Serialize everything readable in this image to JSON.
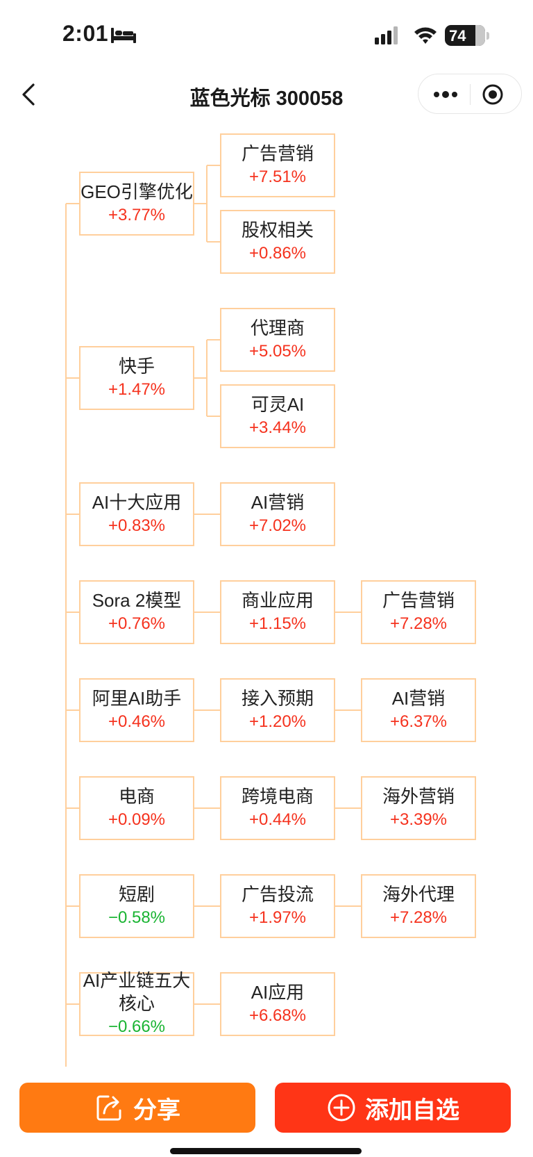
{
  "status_bar": {
    "time": "2:01",
    "battery": "74",
    "battery_level": 0.74
  },
  "nav": {
    "title": "蓝色光标 300058"
  },
  "colors": {
    "node_border": "#ffcf9c",
    "up": "#f5321e",
    "down": "#19b432",
    "share_button": "#ff7a12",
    "add_button": "#ff3516"
  },
  "tree": [
    {
      "label": "GEO引擎优化",
      "change": "+3.77%",
      "trend": "up",
      "children": [
        {
          "label": "广告营销",
          "change": "+7.51%",
          "trend": "up"
        },
        {
          "label": "股权相关",
          "change": "+0.86%",
          "trend": "up"
        }
      ]
    },
    {
      "label": "快手",
      "change": "+1.47%",
      "trend": "up",
      "children": [
        {
          "label": "代理商",
          "change": "+5.05%",
          "trend": "up"
        },
        {
          "label": "可灵AI",
          "change": "+3.44%",
          "trend": "up"
        }
      ]
    },
    {
      "label": "AI十大应用",
      "change": "+0.83%",
      "trend": "up",
      "children": [
        {
          "label": "AI营销",
          "change": "+7.02%",
          "trend": "up"
        }
      ]
    },
    {
      "label": "Sora 2模型",
      "change": "+0.76%",
      "trend": "up",
      "children": [
        {
          "label": "商业应用",
          "change": "+1.15%",
          "trend": "up",
          "children": [
            {
              "label": "广告营销",
              "change": "+7.28%",
              "trend": "up"
            }
          ]
        }
      ]
    },
    {
      "label": "阿里AI助手",
      "change": "+0.46%",
      "trend": "up",
      "children": [
        {
          "label": "接入预期",
          "change": "+1.20%",
          "trend": "up",
          "children": [
            {
              "label": "AI营销",
              "change": "+6.37%",
              "trend": "up"
            }
          ]
        }
      ]
    },
    {
      "label": "电商",
      "change": "+0.09%",
      "trend": "up",
      "children": [
        {
          "label": "跨境电商",
          "change": "+0.44%",
          "trend": "up",
          "children": [
            {
              "label": "海外营销",
              "change": "+3.39%",
              "trend": "up"
            }
          ]
        }
      ]
    },
    {
      "label": "短剧",
      "change": "−0.58%",
      "trend": "down",
      "children": [
        {
          "label": "广告投流",
          "change": "+1.97%",
          "trend": "up",
          "children": [
            {
              "label": "海外代理",
              "change": "+7.28%",
              "trend": "up"
            }
          ]
        }
      ]
    },
    {
      "label": "AI产业链五大核心",
      "change": "−0.66%",
      "trend": "down",
      "children": [
        {
          "label": "AI应用",
          "change": "+6.68%",
          "trend": "up"
        }
      ]
    }
  ],
  "bottom": {
    "share_label": "分享",
    "add_label": "添加自选"
  }
}
